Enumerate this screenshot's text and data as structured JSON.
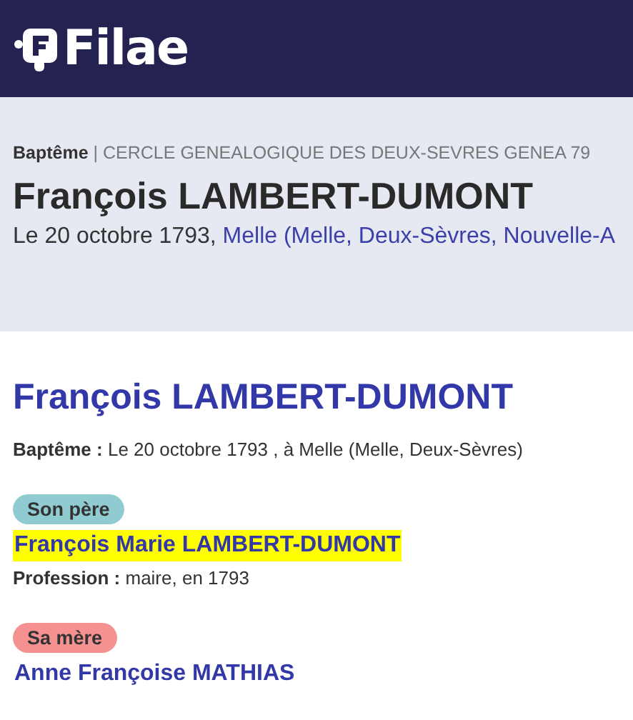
{
  "header": {
    "logo_text": "Filae"
  },
  "record": {
    "type": "Baptême",
    "separator": "|",
    "source": "CERCLE GENEALOGIQUE DES DEUX-SEVRES GENEA 79",
    "title": "François LAMBERT-DUMONT",
    "date": "Le 20 octobre 1793,",
    "place_link": "Melle (Melle, Deux-Sèvres, Nouvelle-A"
  },
  "detail": {
    "name": "François LAMBERT-DUMONT",
    "event_label": "Baptême :",
    "event_text": "Le 20 octobre 1793 , à Melle (Melle, Deux-Sèvres)"
  },
  "relatives": [
    {
      "role": "Son père",
      "color": "#8fcbd0",
      "name": "François Marie LAMBERT-DUMONT",
      "highlighted": true,
      "profession_label": "Profession :",
      "profession": "maire, en 1793"
    },
    {
      "role": "Sa mère",
      "color": "#f59191",
      "name": "Anne Françoise MATHIAS",
      "highlighted": false
    }
  ]
}
